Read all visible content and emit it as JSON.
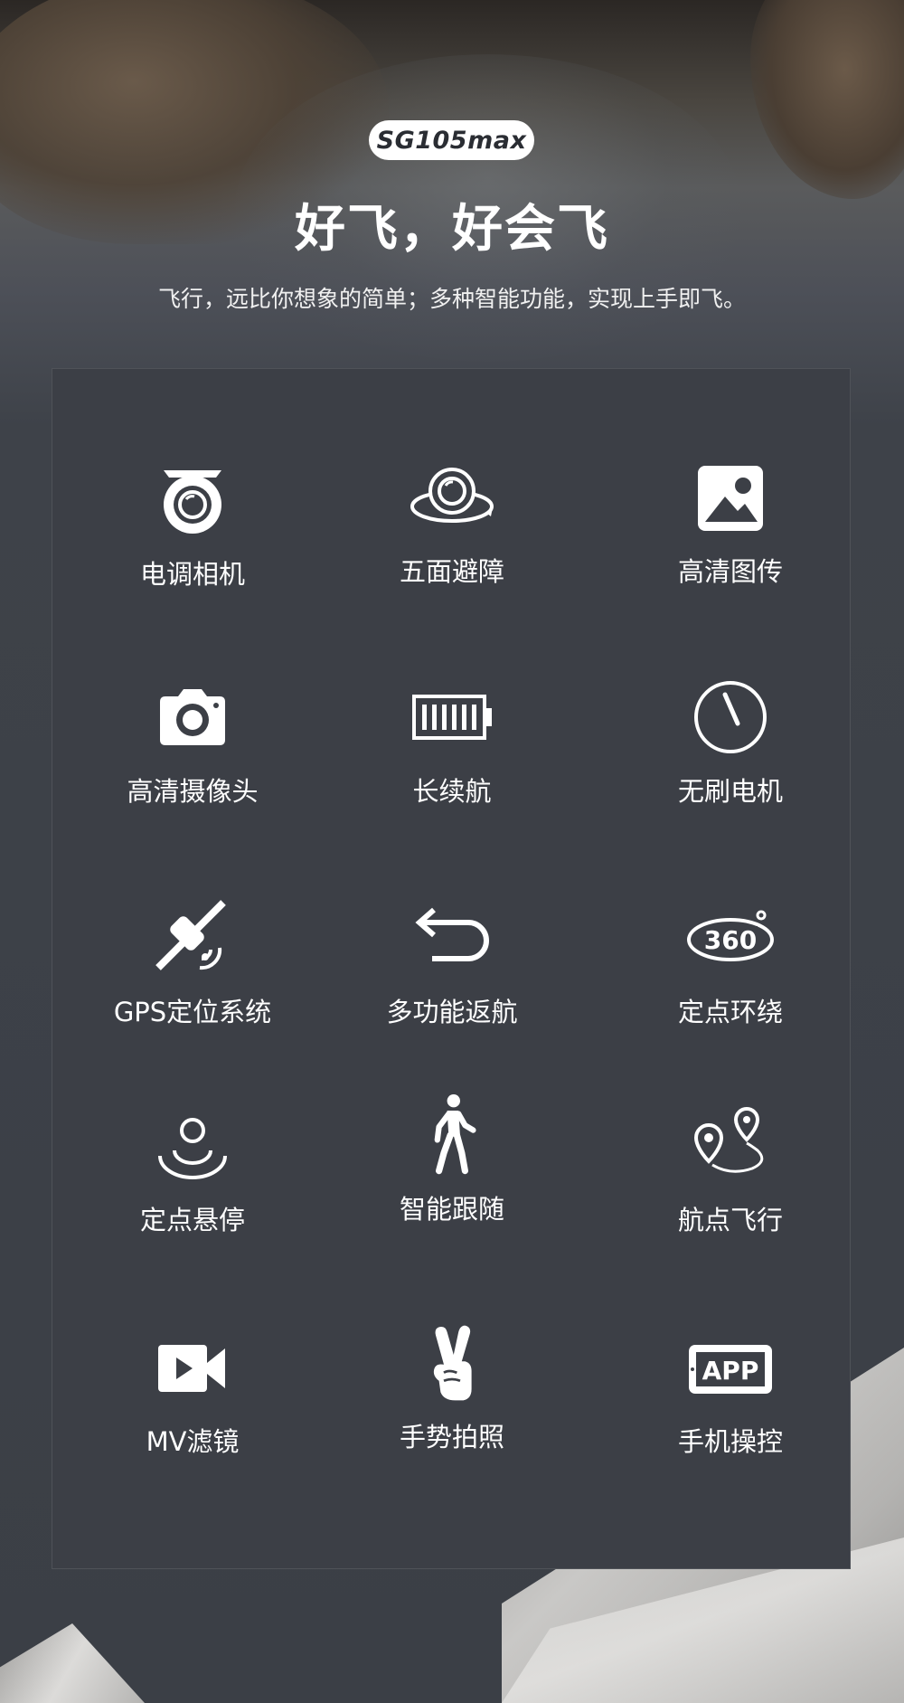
{
  "header": {
    "model_badge": "SG105max",
    "headline": "好飞，好会飞",
    "subline": "飞行，远比你想象的简单；多种智能功能，实现上手即飞。"
  },
  "features": [
    {
      "label": "电调相机",
      "icon": "camera-lens-icon"
    },
    {
      "label": "五面避障",
      "icon": "obstacle-avoidance-icon"
    },
    {
      "label": "高清图传",
      "icon": "image-transmission-icon"
    },
    {
      "label": "高清摄像头",
      "icon": "camera-icon"
    },
    {
      "label": "长续航",
      "icon": "battery-icon"
    },
    {
      "label": "无刷电机",
      "icon": "gauge-icon"
    },
    {
      "label": "GPS定位系统",
      "icon": "satellite-icon"
    },
    {
      "label": "多功能返航",
      "icon": "return-arrow-icon"
    },
    {
      "label": "定点环绕",
      "icon": "orbit-360-icon"
    },
    {
      "label": "定点悬停",
      "icon": "hover-icon"
    },
    {
      "label": "智能跟随",
      "icon": "walking-person-icon"
    },
    {
      "label": "航点飞行",
      "icon": "waypoint-icon"
    },
    {
      "label": "MV滤镜",
      "icon": "video-camera-icon"
    },
    {
      "label": "手势拍照",
      "icon": "victory-hand-icon"
    },
    {
      "label": "手机操控",
      "icon": "app-icon"
    }
  ],
  "app_icon_text": "APP",
  "orbit_icon_text": "360",
  "colors": {
    "background": "#3b3f46",
    "panel": "#3c3f46",
    "text": "#ffffff",
    "badge_bg": "#ffffff",
    "badge_text": "#2a2d33"
  }
}
